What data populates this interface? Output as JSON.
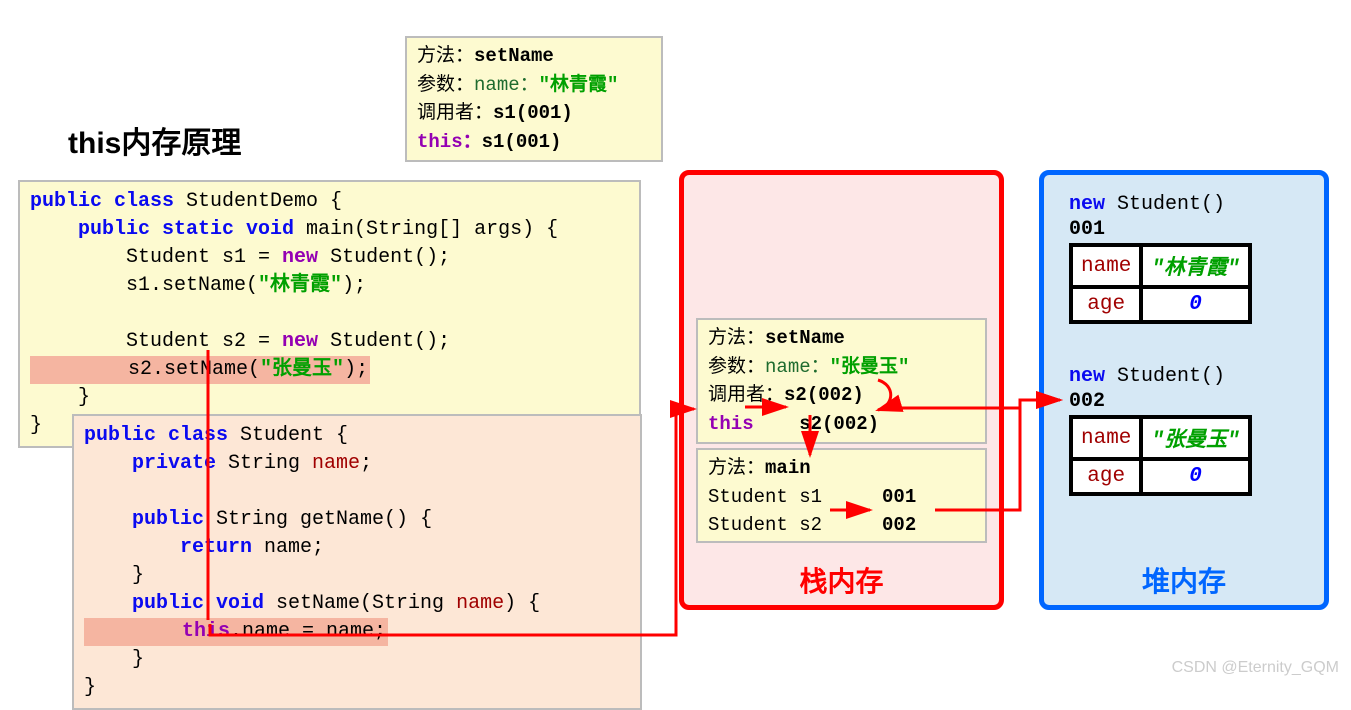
{
  "title": "this内存原理",
  "top_box": {
    "l1a": "方法：",
    "l1b": "setName",
    "l2a": "参数：",
    "l2b": "name：",
    "l2c": "\"林青霞\"",
    "l3a": "调用者：",
    "l3b": "s1(001)",
    "l4a": "this：",
    "l4b": "s1(001)"
  },
  "code1": {
    "l1a": "public class ",
    "l1b": "StudentDemo {",
    "l2a": "    public static void ",
    "l2b": "main(String[] args) {",
    "l3a": "        Student s1 = ",
    "l3b": "new ",
    "l3c": "Student();",
    "l4a": "        s1.setName(",
    "l4b": "\"林青霞\"",
    "l4c": ");",
    "l5": " ",
    "l6a": "        Student s2 = ",
    "l6b": "new ",
    "l6c": "Student();",
    "l7a": "        s2.setName(",
    "l7b": "\"张曼玉\"",
    "l7c": ");",
    "l8": "    }",
    "l9": "}"
  },
  "code2": {
    "l1a": "public class ",
    "l1b": "Student {",
    "l2a": "    private ",
    "l2b": "String ",
    "l2c": "name",
    "l2d": ";",
    "l3": " ",
    "l4a": "    public ",
    "l4b": "String getName() {",
    "l5a": "        return ",
    "l5b": "name;",
    "l6": "    }",
    "l7a": "    public void ",
    "l7b": "setName(String ",
    "l7c": "name",
    "l7d": ") {",
    "l8a": "        ",
    "l8b": "this",
    "l8c": ".name = name;",
    "l9": "    }",
    "l10": "}"
  },
  "stack": {
    "label": "栈内存",
    "f1": {
      "l1a": "方法：",
      "l1b": "setName",
      "l2a": "参数：",
      "l2b": "name：",
      "l2c": "\"张曼玉\"",
      "l3a": "调用者：",
      "l3b": "s2(002)",
      "l4a": "this",
      "l4b": "s2(002)"
    },
    "f2": {
      "l1a": "方法：",
      "l1b": "main",
      "l2a": " Student s1",
      "l2b": "001",
      "l3a": " Student s2",
      "l3b": "002"
    }
  },
  "heap": {
    "label": "堆内存",
    "o1": {
      "head_a": "new ",
      "head_b": "Student()",
      "id": "001",
      "r1k": "name",
      "r1v": "\"林青霞\"",
      "r2k": "age",
      "r2v": "0"
    },
    "o2": {
      "head_a": "new ",
      "head_b": "Student()",
      "id": "002",
      "r1k": "name",
      "r1v": "\"张曼玉\"",
      "r2k": "age",
      "r2v": "0"
    }
  },
  "watermark": "CSDN @Eternity_GQM"
}
